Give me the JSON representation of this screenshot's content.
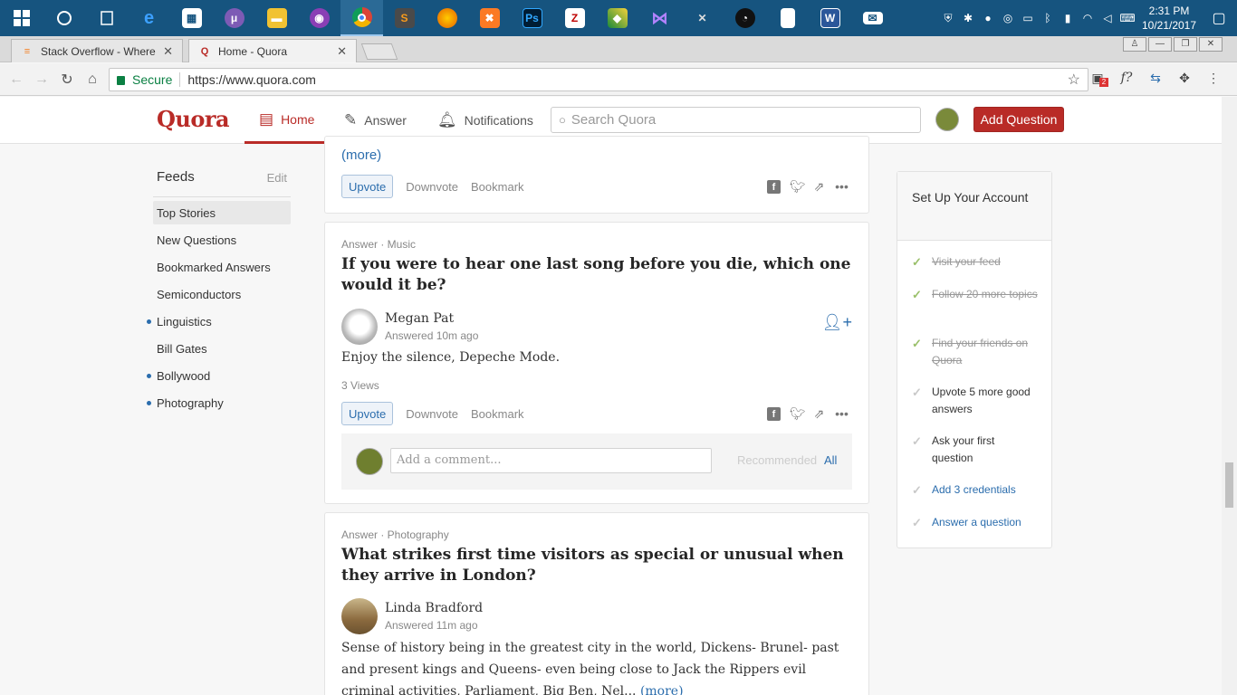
{
  "taskbar": {
    "apps": [
      {
        "icon": "windows-start-icon"
      },
      {
        "icon": "cortana-icon"
      },
      {
        "icon": "task-view-icon"
      },
      {
        "icon": "edge-icon"
      },
      {
        "icon": "store-icon"
      },
      {
        "icon": "bittorrent-icon"
      },
      {
        "icon": "file-explorer-icon"
      },
      {
        "icon": "app-icon"
      },
      {
        "icon": "chrome-icon"
      },
      {
        "icon": "sublime-icon"
      },
      {
        "icon": "firefox-icon"
      },
      {
        "icon": "xampp-icon"
      },
      {
        "icon": "photoshop-icon"
      },
      {
        "icon": "filezilla-icon"
      },
      {
        "icon": "app-icon"
      },
      {
        "icon": "visual-studio-icon"
      },
      {
        "icon": "tool-icon"
      },
      {
        "icon": "speedometer-icon"
      },
      {
        "icon": "notepad-icon"
      },
      {
        "icon": "word-icon"
      },
      {
        "icon": "mail-icon"
      }
    ],
    "time": "2:31 PM",
    "date": "10/21/2017"
  },
  "tabs": [
    {
      "title": "Stack Overflow - Where D",
      "active": false
    },
    {
      "title": "Home - Quora",
      "active": true
    }
  ],
  "address": {
    "secure_label": "Secure",
    "url": "https://www.quora.com",
    "ext_badge": "2"
  },
  "header": {
    "logo": "Quora",
    "home": "Home",
    "answer": "Answer",
    "notifications": "Notifications",
    "search_placeholder": "Search Quora",
    "add_question": "Add Question"
  },
  "sidebar": {
    "title": "Feeds",
    "edit": "Edit",
    "items": [
      {
        "label": "Top Stories",
        "selected": true,
        "dot": false
      },
      {
        "label": "New Questions",
        "dot": false
      },
      {
        "label": "Bookmarked Answers",
        "dot": false
      },
      {
        "label": "Semiconductors",
        "dot": false
      },
      {
        "label": "Linguistics",
        "dot": true
      },
      {
        "label": "Bill Gates",
        "dot": false
      },
      {
        "label": "Bollywood",
        "dot": true
      },
      {
        "label": "Photography",
        "dot": true
      }
    ]
  },
  "feed": {
    "card1": {
      "more": "(more)",
      "upvote": "Upvote",
      "downvote": "Downvote",
      "bookmark": "Bookmark"
    },
    "card2": {
      "meta": "Answer · Music",
      "title": "If you were to hear one last song before you die, which one would it be?",
      "author": "Megan Pat",
      "time": "Answered 10m ago",
      "body": "Enjoy the silence, Depeche Mode.",
      "views": "3 Views",
      "upvote": "Upvote",
      "downvote": "Downvote",
      "bookmark": "Bookmark",
      "comment_placeholder": "Add a comment...",
      "recommended": "Recommended",
      "all": "All"
    },
    "card3": {
      "meta": "Answer · Photography",
      "title": "What strikes first time visitors as special or unusual when they arrive in London?",
      "author": "Linda Bradford",
      "time": "Answered 11m ago",
      "body": "Sense of history being in the greatest city in the world, Dickens- Brunel- past and present kings and Queens- even being close to Jack the Rippers evil criminal activities, Parliament, Big Ben, Nel...",
      "more": "(more)"
    }
  },
  "setup": {
    "title": "Set Up Your Account",
    "items": [
      {
        "label": "Visit your feed",
        "state": "done"
      },
      {
        "label": "Follow 20 more topics",
        "state": "done"
      },
      {
        "label": "Find your friends on Quora",
        "state": "done"
      },
      {
        "label": "Upvote 5 more good answers",
        "state": "todo"
      },
      {
        "label": "Ask your first question",
        "state": "todo"
      },
      {
        "label": "Add 3 credentials",
        "state": "link"
      },
      {
        "label": "Answer a question",
        "state": "link"
      }
    ]
  }
}
